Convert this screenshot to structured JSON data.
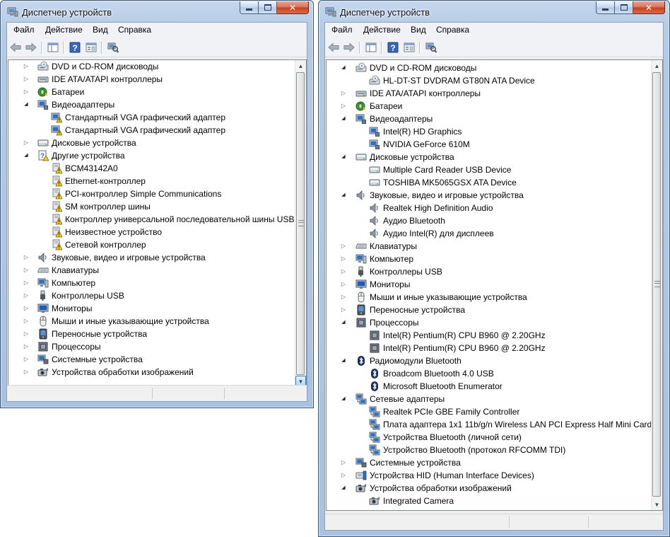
{
  "windows": [
    {
      "title": "Диспетчер устройств",
      "menu": [
        "Файл",
        "Действие",
        "Вид",
        "Справка"
      ],
      "tree": [
        {
          "level": 0,
          "exp": "collapsed",
          "icon": "dvd",
          "label": "DVD и CD-ROM дисководы"
        },
        {
          "level": 0,
          "exp": "collapsed",
          "icon": "ide",
          "label": "IDE ATA/ATAPI контроллеры"
        },
        {
          "level": 0,
          "exp": "collapsed",
          "icon": "battery",
          "label": "Батареи"
        },
        {
          "level": 0,
          "exp": "expanded",
          "icon": "display",
          "label": "Видеоадаптеры"
        },
        {
          "level": 1,
          "exp": "none",
          "icon": "display-warn",
          "label": "Стандартный VGA графический адаптер"
        },
        {
          "level": 1,
          "exp": "none",
          "icon": "display-warn",
          "label": "Стандартный VGA графический адаптер"
        },
        {
          "level": 0,
          "exp": "collapsed",
          "icon": "disk",
          "label": "Дисковые устройства"
        },
        {
          "level": 0,
          "exp": "expanded",
          "icon": "unknown",
          "label": "Другие устройства"
        },
        {
          "level": 1,
          "exp": "none",
          "icon": "warn",
          "label": "BCM43142A0"
        },
        {
          "level": 1,
          "exp": "none",
          "icon": "warn",
          "label": "Ethernet-контроллер"
        },
        {
          "level": 1,
          "exp": "none",
          "icon": "warn",
          "label": "PCI-контроллер Simple Communications"
        },
        {
          "level": 1,
          "exp": "none",
          "icon": "warn",
          "label": "SM контроллер шины"
        },
        {
          "level": 1,
          "exp": "none",
          "icon": "warn",
          "label": "Контроллер универсальной последовательной шины USB"
        },
        {
          "level": 1,
          "exp": "none",
          "icon": "warn",
          "label": "Неизвестное устройство"
        },
        {
          "level": 1,
          "exp": "none",
          "icon": "warn",
          "label": "Сетевой контроллер"
        },
        {
          "level": 0,
          "exp": "collapsed",
          "icon": "sound",
          "label": "Звуковые, видео и игровые устройства"
        },
        {
          "level": 0,
          "exp": "collapsed",
          "icon": "keyboard",
          "label": "Клавиатуры"
        },
        {
          "level": 0,
          "exp": "collapsed",
          "icon": "computer",
          "label": "Компьютер"
        },
        {
          "level": 0,
          "exp": "collapsed",
          "icon": "usb",
          "label": "Контроллеры USB"
        },
        {
          "level": 0,
          "exp": "collapsed",
          "icon": "monitor",
          "label": "Мониторы"
        },
        {
          "level": 0,
          "exp": "collapsed",
          "icon": "mouse",
          "label": "Мыши и иные указывающие устройства"
        },
        {
          "level": 0,
          "exp": "collapsed",
          "icon": "portable",
          "label": "Переносные устройства"
        },
        {
          "level": 0,
          "exp": "collapsed",
          "icon": "cpu",
          "label": "Процессоры"
        },
        {
          "level": 0,
          "exp": "collapsed",
          "icon": "system",
          "label": "Системные устройства"
        },
        {
          "level": 0,
          "exp": "collapsed",
          "icon": "camera",
          "label": "Устройства обработки изображений"
        }
      ]
    },
    {
      "title": "Диспетчер устройств",
      "menu": [
        "Файл",
        "Действие",
        "Вид",
        "Справка"
      ],
      "tree": [
        {
          "level": 0,
          "exp": "expanded",
          "icon": "dvd",
          "label": "DVD и CD-ROM дисководы"
        },
        {
          "level": 1,
          "exp": "none",
          "icon": "dvd",
          "label": "HL-DT-ST DVDRAM GT80N ATA Device"
        },
        {
          "level": 0,
          "exp": "collapsed",
          "icon": "ide",
          "label": "IDE ATA/ATAPI контроллеры"
        },
        {
          "level": 0,
          "exp": "collapsed",
          "icon": "battery",
          "label": "Батареи"
        },
        {
          "level": 0,
          "exp": "expanded",
          "icon": "display",
          "label": "Видеоадаптеры"
        },
        {
          "level": 1,
          "exp": "none",
          "icon": "display",
          "label": "Intel(R) HD Graphics"
        },
        {
          "level": 1,
          "exp": "none",
          "icon": "display",
          "label": "NVIDIA GeForce 610M"
        },
        {
          "level": 0,
          "exp": "expanded",
          "icon": "disk",
          "label": "Дисковые устройства"
        },
        {
          "level": 1,
          "exp": "none",
          "icon": "disk",
          "label": "Multiple Card  Reader USB Device"
        },
        {
          "level": 1,
          "exp": "none",
          "icon": "disk",
          "label": "TOSHIBA MK5065GSX ATA Device"
        },
        {
          "level": 0,
          "exp": "expanded",
          "icon": "sound",
          "label": "Звуковые, видео и игровые устройства"
        },
        {
          "level": 1,
          "exp": "none",
          "icon": "sound",
          "label": "Realtek High Definition Audio"
        },
        {
          "level": 1,
          "exp": "none",
          "icon": "sound",
          "label": "Аудио Bluetooth"
        },
        {
          "level": 1,
          "exp": "none",
          "icon": "sound",
          "label": "Аудио Intel(R) для дисплеев"
        },
        {
          "level": 0,
          "exp": "collapsed",
          "icon": "keyboard",
          "label": "Клавиатуры"
        },
        {
          "level": 0,
          "exp": "collapsed",
          "icon": "computer",
          "label": "Компьютер"
        },
        {
          "level": 0,
          "exp": "collapsed",
          "icon": "usb",
          "label": "Контроллеры USB"
        },
        {
          "level": 0,
          "exp": "collapsed",
          "icon": "monitor",
          "label": "Мониторы"
        },
        {
          "level": 0,
          "exp": "collapsed",
          "icon": "mouse",
          "label": "Мыши и иные указывающие устройства"
        },
        {
          "level": 0,
          "exp": "collapsed",
          "icon": "portable",
          "label": "Переносные устройства"
        },
        {
          "level": 0,
          "exp": "expanded",
          "icon": "cpu",
          "label": "Процессоры"
        },
        {
          "level": 1,
          "exp": "none",
          "icon": "cpu",
          "label": "Intel(R) Pentium(R) CPU B960 @ 2.20GHz"
        },
        {
          "level": 1,
          "exp": "none",
          "icon": "cpu",
          "label": "Intel(R) Pentium(R) CPU B960 @ 2.20GHz"
        },
        {
          "level": 0,
          "exp": "expanded",
          "icon": "bluetooth",
          "label": "Радиомодули Bluetooth"
        },
        {
          "level": 1,
          "exp": "none",
          "icon": "bluetooth",
          "label": "Broadcom Bluetooth 4.0 USB"
        },
        {
          "level": 1,
          "exp": "none",
          "icon": "bluetooth",
          "label": "Microsoft Bluetooth Enumerator"
        },
        {
          "level": 0,
          "exp": "expanded",
          "icon": "network",
          "label": "Сетевые адаптеры"
        },
        {
          "level": 1,
          "exp": "none",
          "icon": "network",
          "label": "Realtek PCIe GBE Family Controller"
        },
        {
          "level": 1,
          "exp": "none",
          "icon": "network",
          "label": "Плата адаптера 1x1 11b/g/n Wireless LAN PCI Express Half Mini Card"
        },
        {
          "level": 1,
          "exp": "none",
          "icon": "network",
          "label": "Устройства Bluetooth (личной сети)"
        },
        {
          "level": 1,
          "exp": "none",
          "icon": "network",
          "label": "Устройство Bluetooth (протокол RFCOMM TDI)"
        },
        {
          "level": 0,
          "exp": "collapsed",
          "icon": "system",
          "label": "Системные устройства"
        },
        {
          "level": 0,
          "exp": "collapsed",
          "icon": "hid",
          "label": "Устройства HID (Human Interface Devices)"
        },
        {
          "level": 0,
          "exp": "expanded",
          "icon": "camera",
          "label": "Устройства обработки изображений"
        },
        {
          "level": 1,
          "exp": "none",
          "icon": "camera",
          "label": "Integrated Camera"
        }
      ]
    }
  ]
}
